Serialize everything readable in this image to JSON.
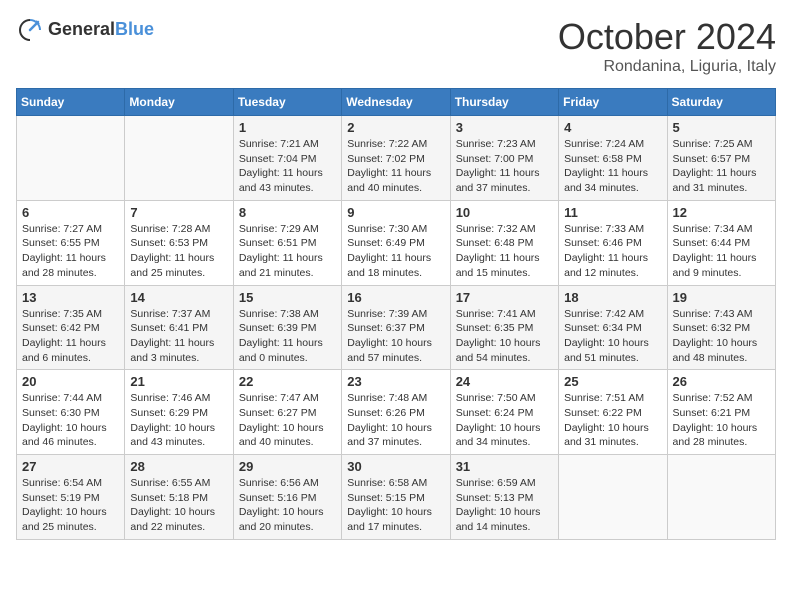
{
  "header": {
    "logo": {
      "general": "General",
      "blue": "Blue"
    },
    "title": "October 2024",
    "location": "Rondanina, Liguria, Italy"
  },
  "calendar": {
    "days_of_week": [
      "Sunday",
      "Monday",
      "Tuesday",
      "Wednesday",
      "Thursday",
      "Friday",
      "Saturday"
    ],
    "weeks": [
      [
        {
          "day": "",
          "info": ""
        },
        {
          "day": "",
          "info": ""
        },
        {
          "day": "1",
          "info": "Sunrise: 7:21 AM\nSunset: 7:04 PM\nDaylight: 11 hours and 43 minutes."
        },
        {
          "day": "2",
          "info": "Sunrise: 7:22 AM\nSunset: 7:02 PM\nDaylight: 11 hours and 40 minutes."
        },
        {
          "day": "3",
          "info": "Sunrise: 7:23 AM\nSunset: 7:00 PM\nDaylight: 11 hours and 37 minutes."
        },
        {
          "day": "4",
          "info": "Sunrise: 7:24 AM\nSunset: 6:58 PM\nDaylight: 11 hours and 34 minutes."
        },
        {
          "day": "5",
          "info": "Sunrise: 7:25 AM\nSunset: 6:57 PM\nDaylight: 11 hours and 31 minutes."
        }
      ],
      [
        {
          "day": "6",
          "info": "Sunrise: 7:27 AM\nSunset: 6:55 PM\nDaylight: 11 hours and 28 minutes."
        },
        {
          "day": "7",
          "info": "Sunrise: 7:28 AM\nSunset: 6:53 PM\nDaylight: 11 hours and 25 minutes."
        },
        {
          "day": "8",
          "info": "Sunrise: 7:29 AM\nSunset: 6:51 PM\nDaylight: 11 hours and 21 minutes."
        },
        {
          "day": "9",
          "info": "Sunrise: 7:30 AM\nSunset: 6:49 PM\nDaylight: 11 hours and 18 minutes."
        },
        {
          "day": "10",
          "info": "Sunrise: 7:32 AM\nSunset: 6:48 PM\nDaylight: 11 hours and 15 minutes."
        },
        {
          "day": "11",
          "info": "Sunrise: 7:33 AM\nSunset: 6:46 PM\nDaylight: 11 hours and 12 minutes."
        },
        {
          "day": "12",
          "info": "Sunrise: 7:34 AM\nSunset: 6:44 PM\nDaylight: 11 hours and 9 minutes."
        }
      ],
      [
        {
          "day": "13",
          "info": "Sunrise: 7:35 AM\nSunset: 6:42 PM\nDaylight: 11 hours and 6 minutes."
        },
        {
          "day": "14",
          "info": "Sunrise: 7:37 AM\nSunset: 6:41 PM\nDaylight: 11 hours and 3 minutes."
        },
        {
          "day": "15",
          "info": "Sunrise: 7:38 AM\nSunset: 6:39 PM\nDaylight: 11 hours and 0 minutes."
        },
        {
          "day": "16",
          "info": "Sunrise: 7:39 AM\nSunset: 6:37 PM\nDaylight: 10 hours and 57 minutes."
        },
        {
          "day": "17",
          "info": "Sunrise: 7:41 AM\nSunset: 6:35 PM\nDaylight: 10 hours and 54 minutes."
        },
        {
          "day": "18",
          "info": "Sunrise: 7:42 AM\nSunset: 6:34 PM\nDaylight: 10 hours and 51 minutes."
        },
        {
          "day": "19",
          "info": "Sunrise: 7:43 AM\nSunset: 6:32 PM\nDaylight: 10 hours and 48 minutes."
        }
      ],
      [
        {
          "day": "20",
          "info": "Sunrise: 7:44 AM\nSunset: 6:30 PM\nDaylight: 10 hours and 46 minutes."
        },
        {
          "day": "21",
          "info": "Sunrise: 7:46 AM\nSunset: 6:29 PM\nDaylight: 10 hours and 43 minutes."
        },
        {
          "day": "22",
          "info": "Sunrise: 7:47 AM\nSunset: 6:27 PM\nDaylight: 10 hours and 40 minutes."
        },
        {
          "day": "23",
          "info": "Sunrise: 7:48 AM\nSunset: 6:26 PM\nDaylight: 10 hours and 37 minutes."
        },
        {
          "day": "24",
          "info": "Sunrise: 7:50 AM\nSunset: 6:24 PM\nDaylight: 10 hours and 34 minutes."
        },
        {
          "day": "25",
          "info": "Sunrise: 7:51 AM\nSunset: 6:22 PM\nDaylight: 10 hours and 31 minutes."
        },
        {
          "day": "26",
          "info": "Sunrise: 7:52 AM\nSunset: 6:21 PM\nDaylight: 10 hours and 28 minutes."
        }
      ],
      [
        {
          "day": "27",
          "info": "Sunrise: 6:54 AM\nSunset: 5:19 PM\nDaylight: 10 hours and 25 minutes."
        },
        {
          "day": "28",
          "info": "Sunrise: 6:55 AM\nSunset: 5:18 PM\nDaylight: 10 hours and 22 minutes."
        },
        {
          "day": "29",
          "info": "Sunrise: 6:56 AM\nSunset: 5:16 PM\nDaylight: 10 hours and 20 minutes."
        },
        {
          "day": "30",
          "info": "Sunrise: 6:58 AM\nSunset: 5:15 PM\nDaylight: 10 hours and 17 minutes."
        },
        {
          "day": "31",
          "info": "Sunrise: 6:59 AM\nSunset: 5:13 PM\nDaylight: 10 hours and 14 minutes."
        },
        {
          "day": "",
          "info": ""
        },
        {
          "day": "",
          "info": ""
        }
      ]
    ]
  }
}
